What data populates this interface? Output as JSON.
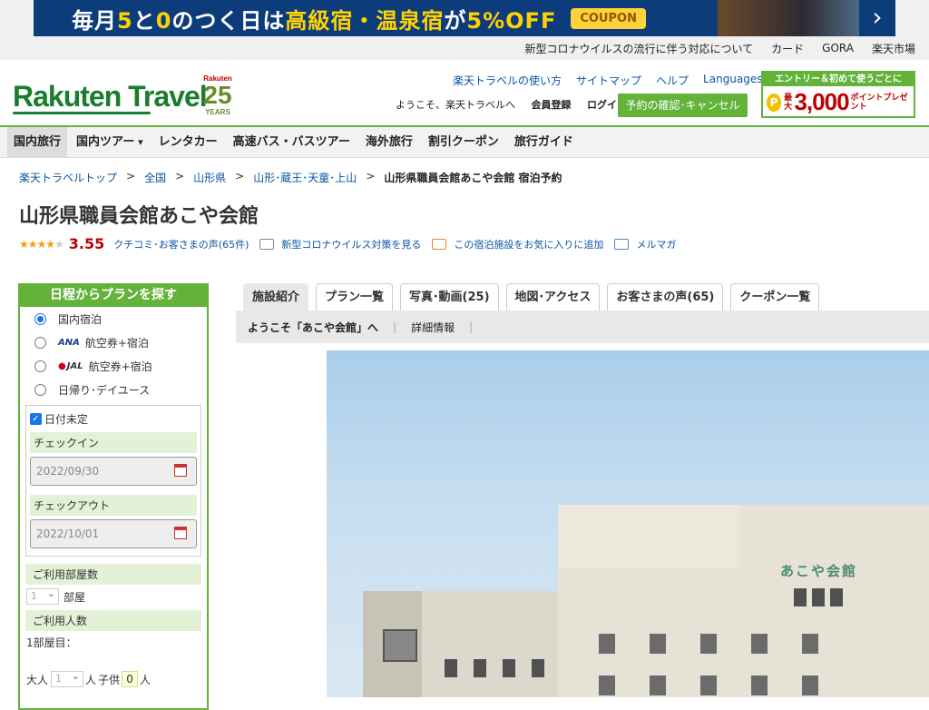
{
  "banner": {
    "text_a": "毎月",
    "text_b": "5",
    "text_c": "と",
    "text_d": "0",
    "text_e": "のつく日は",
    "text_f": "高級宿・温泉宿",
    "text_g": "が",
    "text_h": "5%OFF",
    "coupon": "COUPON"
  },
  "utility_links": [
    "新型コロナウイルスの流行に伴う対応について",
    "カード",
    "GORA",
    "楽天市場"
  ],
  "header": {
    "logo": "Rakuten Travel",
    "anniv_brand": "Rakuten",
    "anniv_number": "25",
    "anniv_years": "YEARS",
    "links": [
      "楽天トラベルの使い方",
      "サイトマップ",
      "ヘルプ",
      "Languages"
    ],
    "welcome": "ようこそ、楽天トラベルへ",
    "register": "会員登録",
    "login": "ログイン",
    "reservation_button": "予約の確認･キャンセル",
    "promo": {
      "headline": "エントリー＆初めて使うごとに",
      "coin": "P",
      "max": "最大",
      "amount": "3,000",
      "unit": "ポイントプレゼント"
    }
  },
  "main_nav": [
    "国内旅行",
    "国内ツアー",
    "レンタカー",
    "高速バス・バスツアー",
    "海外旅行",
    "割引クーポン",
    "旅行ガイド"
  ],
  "breadcrumb": {
    "items": [
      "楽天トラベルトップ",
      "全国",
      "山形県",
      "山形･蔵王･天童･上山"
    ],
    "current": "山形県職員会館あこや会館 宿泊予約"
  },
  "hotel": {
    "name": "山形県職員会館あこや会館",
    "stars": 3.55,
    "score": "3.55",
    "reviews_link": "クチコミ･お客さまの声(65件)",
    "covid_link": "新型コロナウイルス対策を見る",
    "favorite_link": "この宿泊施設をお気に入りに追加",
    "mailmag_link": "メルマガ"
  },
  "search": {
    "title": "日程からプランを探す",
    "options": [
      {
        "airline": "",
        "label": "国内宿泊",
        "selected": true
      },
      {
        "airline": "ANA",
        "label": "航空券+宿泊",
        "selected": false
      },
      {
        "airline": "JAL",
        "label": "航空券+宿泊",
        "selected": false
      },
      {
        "airline": "",
        "label": "日帰り･デイユース",
        "selected": false
      }
    ],
    "undecided_label": "日付未定",
    "undecided_checked": true,
    "checkin_label": "チェックイン",
    "checkin_value": "2022/09/30",
    "checkout_label": "チェックアウト",
    "checkout_value": "2022/10/01",
    "rooms_label": "ご利用部屋数",
    "rooms_value": "1",
    "rooms_unit": "部屋",
    "guests_label": "ご利用人数",
    "room1_label": "1部屋目：",
    "adult_label": "大人",
    "adult_value": "1",
    "adult_unit": "人",
    "child_label": "子供",
    "child_value": "0",
    "child_unit": "人"
  },
  "tabs": [
    "施設紹介",
    "プラン一覧",
    "写真･動画(25)",
    "地図･アクセス",
    "お客さまの声(65)",
    "クーポン一覧"
  ],
  "subnav": [
    "ようこそ「あこや会館」へ",
    "詳細情報"
  ],
  "photo": {
    "sign": "あこや会館"
  },
  "colors": {
    "brand_green": "#63b23a",
    "logo_green": "#1a7d2e",
    "price_red": "#bf0000",
    "link_blue": "#0b55a3"
  }
}
